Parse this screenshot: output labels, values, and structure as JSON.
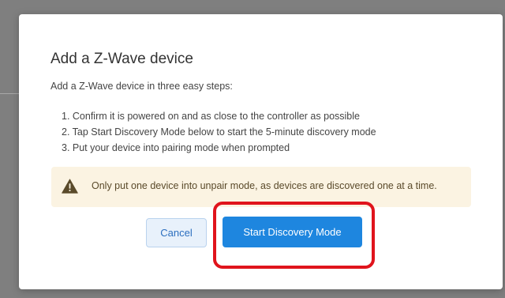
{
  "dialog": {
    "title": "Add a Z-Wave device",
    "intro": "Add a Z-Wave device in three easy steps:",
    "steps": [
      "1. Confirm it is powered on and as close to the controller as possible",
      "2. Tap Start Discovery Mode below to start the 5-minute discovery mode",
      "3. Put your device into pairing mode when prompted"
    ],
    "warning": {
      "icon": "warning-triangle-icon",
      "text": "Only put one device into unpair mode, as devices are discovered one at a time."
    },
    "buttons": {
      "cancel_label": "Cancel",
      "start_label": "Start Discovery Mode"
    }
  },
  "colors": {
    "primary": "#1e86df",
    "warning_bg": "#fbf3e2",
    "highlight": "#e0141c",
    "backdrop": "#7f7f7f"
  }
}
